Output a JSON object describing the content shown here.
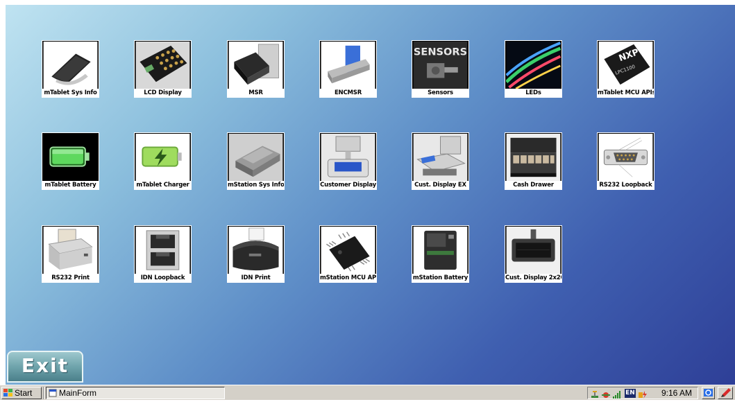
{
  "tiles": [
    {
      "label": "mTablet Sys Info",
      "icon": "tablet-icon"
    },
    {
      "label": "LCD Display",
      "icon": "lcd-keypad-icon"
    },
    {
      "label": "MSR",
      "icon": "card-reader-icon"
    },
    {
      "label": "ENCMSR",
      "icon": "encrypted-card-reader-icon"
    },
    {
      "label": "Sensors",
      "icon": "sensors-icon"
    },
    {
      "label": "LEDs",
      "icon": "led-strip-icon"
    },
    {
      "label": "mTablet MCU APIs",
      "icon": "nxp-chip-icon"
    },
    {
      "label": "mTablet Battery",
      "icon": "battery-icon"
    },
    {
      "label": "mTablet Charger",
      "icon": "charger-icon"
    },
    {
      "label": "mStation Sys Info",
      "icon": "station-icon"
    },
    {
      "label": "Customer Display",
      "icon": "customer-display-icon"
    },
    {
      "label": "Cust. Display EX",
      "icon": "customer-display-ex-icon"
    },
    {
      "label": "Cash Drawer",
      "icon": "cash-drawer-icon"
    },
    {
      "label": "RS232 Loopback",
      "icon": "serial-port-icon"
    },
    {
      "label": "RS232 Print",
      "icon": "receipt-printer-icon"
    },
    {
      "label": "IDN Loopback",
      "icon": "ethernet-port-icon"
    },
    {
      "label": "IDN Print",
      "icon": "thermal-printer-icon"
    },
    {
      "label": "mStation MCU API",
      "icon": "mcu-chip-icon"
    },
    {
      "label": "mStation Battery",
      "icon": "battery-pack-icon"
    },
    {
      "label": "Cust. Display 2x20",
      "icon": "pole-display-icon"
    }
  ],
  "exit_label": "Exit",
  "taskbar": {
    "start_label": "Start",
    "task_label": "MainForm",
    "lang": "EN",
    "clock": "9:16 AM"
  },
  "art_text": {
    "sensors": "SENSORS",
    "nxp": "NXP",
    "lpc": "LPC1100"
  },
  "colors": {
    "desktop_start": "#bfe3f1",
    "desktop_end": "#2e3f97",
    "exit_button": "#6fa4ac",
    "taskbar": "#d4d0c8"
  }
}
